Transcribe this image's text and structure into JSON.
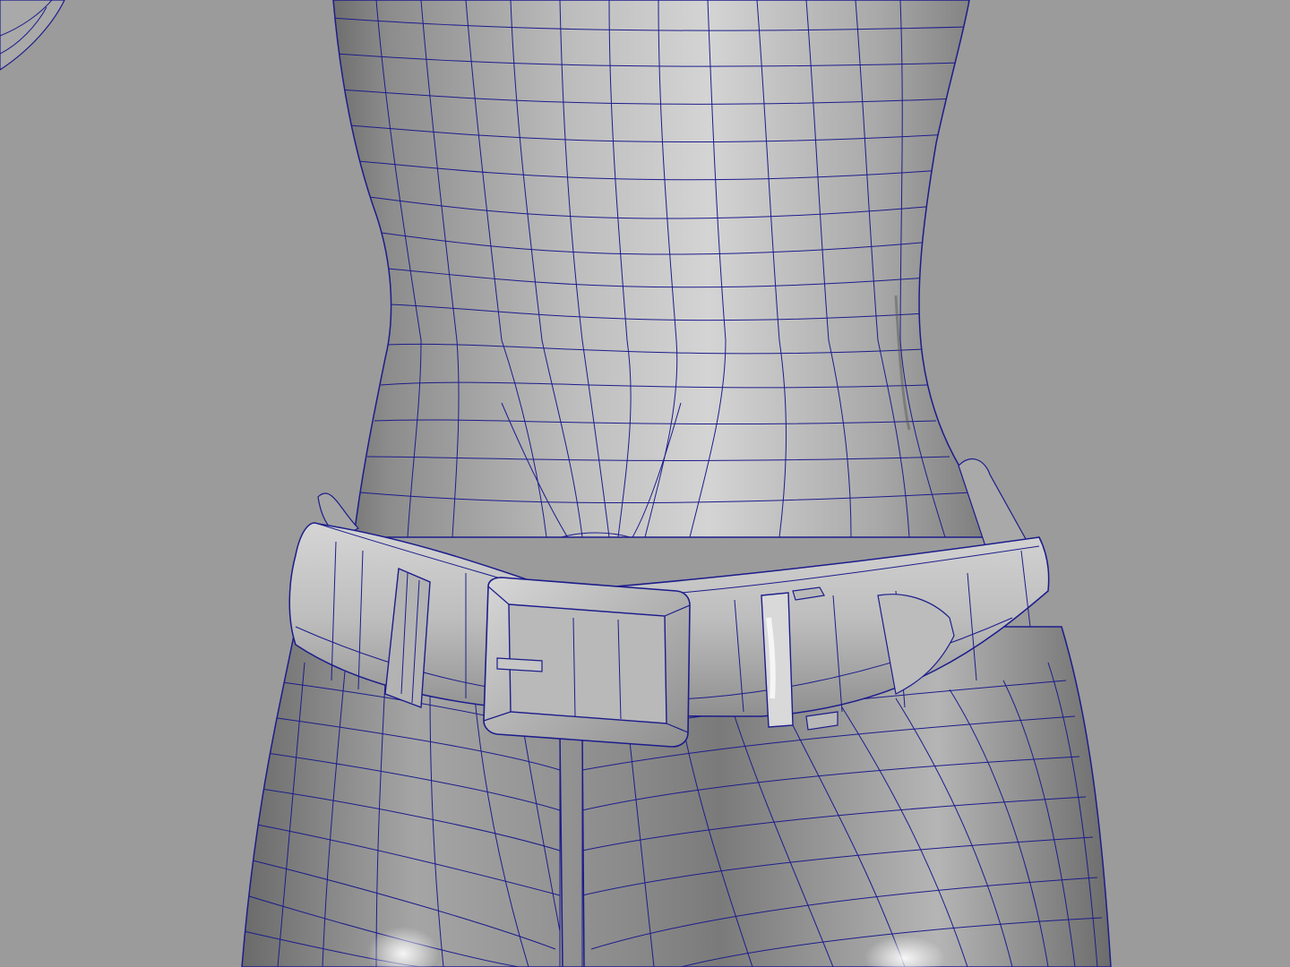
{
  "viewport": {
    "background": "#9b9b9b",
    "wire_color": "#1c1c8c",
    "shade_dark": "#6f6f6f",
    "shade_light": "#c6c6c6",
    "highlight": "#f2f2f2"
  },
  "model": {
    "parts": [
      "torso-mesh",
      "belt-mesh",
      "buckle-mesh",
      "belt-loop-left",
      "belt-loop-right",
      "left-arm-mesh"
    ]
  }
}
